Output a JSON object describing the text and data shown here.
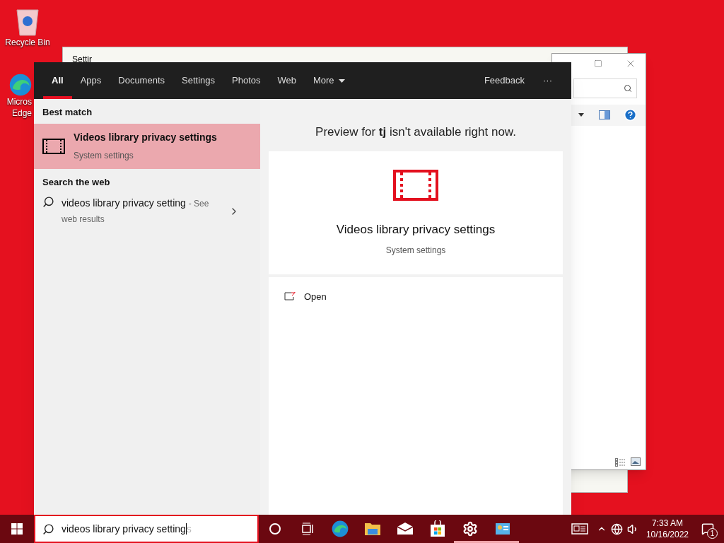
{
  "desktop_icons": [
    {
      "kind": "recycle",
      "lines": [
        "Recycle Bin"
      ]
    },
    {
      "kind": "edge",
      "lines": [
        "Micros",
        "Edge"
      ]
    }
  ],
  "background_window": {
    "title": "Settir"
  },
  "search_panel": {
    "tabs": [
      {
        "label": "All",
        "selected": true
      },
      {
        "label": "Apps",
        "selected": false
      },
      {
        "label": "Documents",
        "selected": false
      },
      {
        "label": "Settings",
        "selected": false
      },
      {
        "label": "Photos",
        "selected": false
      },
      {
        "label": "Web",
        "selected": false
      },
      {
        "label": "More",
        "selected": false
      }
    ],
    "feedback": "Feedback",
    "overflow": "···",
    "best_match_heading": "Best match",
    "best_match": {
      "title": "Videos library privacy settings",
      "subtitle": "System settings",
      "selected": true
    },
    "web_heading": "Search the web",
    "web_result": {
      "query": "videos library privacy setting",
      "suffix": "- See web results"
    },
    "preview": {
      "notice": "Preview for **tj** isn't available right now.",
      "title": "Videos library privacy settings",
      "subtitle": "System settings",
      "actions": [
        {
          "label": "Open"
        }
      ]
    }
  },
  "taskbar": {
    "search": {
      "value": "videos library privacy setting",
      "suggestion": "s"
    },
    "apps": [
      {
        "kind": "cortana",
        "running": false
      },
      {
        "kind": "taskview",
        "running": false
      },
      {
        "kind": "edge",
        "running": false
      },
      {
        "kind": "folder",
        "running": false
      },
      {
        "kind": "mail",
        "running": false
      },
      {
        "kind": "store",
        "running": false
      },
      {
        "kind": "gear",
        "running": true
      },
      {
        "kind": "control",
        "running": true
      }
    ],
    "time": "7:33 AM",
    "date": "10/16/2022",
    "notifications": "1"
  }
}
